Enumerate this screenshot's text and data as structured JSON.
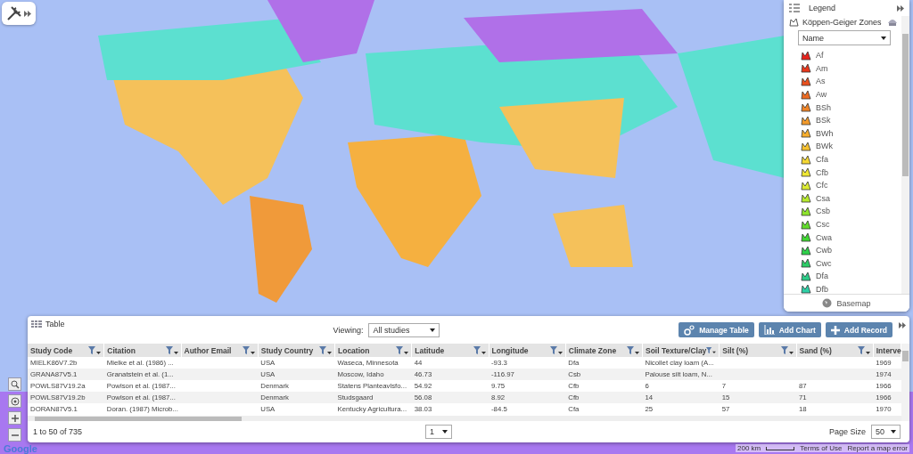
{
  "legend": {
    "title": "Legend",
    "layer": "Köppen-Geiger Zones",
    "field": "Name",
    "items": [
      {
        "label": "Af",
        "color": "#e8231c"
      },
      {
        "label": "Am",
        "color": "#e8381c"
      },
      {
        "label": "As",
        "color": "#e8501e"
      },
      {
        "label": "Aw",
        "color": "#ec6a22"
      },
      {
        "label": "BSh",
        "color": "#ef8427"
      },
      {
        "label": "BSk",
        "color": "#f29a2b"
      },
      {
        "label": "BWh",
        "color": "#f5ad2e"
      },
      {
        "label": "BWk",
        "color": "#f5c130"
      },
      {
        "label": "Cfa",
        "color": "#f5d833"
      },
      {
        "label": "Cfb",
        "color": "#eee634"
      },
      {
        "label": "Cfc",
        "color": "#dcec33"
      },
      {
        "label": "Csa",
        "color": "#b6ea2e"
      },
      {
        "label": "Csb",
        "color": "#8ee42c"
      },
      {
        "label": "Csc",
        "color": "#62dc2c"
      },
      {
        "label": "Cwa",
        "color": "#3fd632"
      },
      {
        "label": "Cwb",
        "color": "#2ed04a"
      },
      {
        "label": "Cwc",
        "color": "#2ccc66"
      },
      {
        "label": "Dfa",
        "color": "#2ccc88"
      },
      {
        "label": "Dfb",
        "color": "#2ed0a6"
      }
    ],
    "basemap": "Basemap"
  },
  "table": {
    "title": "Table",
    "viewing_label": "Viewing:",
    "viewing": "All studies",
    "buttons": [
      {
        "label": "Manage Table",
        "kind": "gears"
      },
      {
        "label": "Add Chart",
        "kind": "chart"
      },
      {
        "label": "Add Record",
        "kind": "plus"
      }
    ],
    "columns": [
      {
        "label": "Study Code",
        "filter": true
      },
      {
        "label": "Citation",
        "filter": true
      },
      {
        "label": "Author Email",
        "filter": true
      },
      {
        "label": "Study Country",
        "filter": true
      },
      {
        "label": "Location",
        "filter": true
      },
      {
        "label": "Latitude",
        "filter": true
      },
      {
        "label": "Longitude",
        "filter": true
      },
      {
        "label": "Climate Zone",
        "filter": true
      },
      {
        "label": "Soil Texture/Clay",
        "filter": true
      },
      {
        "label": "Silt (%)",
        "filter": true
      },
      {
        "label": "Sand (%)",
        "filter": true
      },
      {
        "label": "Interve",
        "filter": false
      }
    ],
    "rows": [
      [
        "MIELK86V7.2b",
        "Mielke et al. (1986) ...",
        "",
        "USA",
        "Waseca, Minnesota",
        "44",
        "-93.3",
        "Dfa",
        "Nicollet clay loam (A...",
        "",
        "",
        "1969"
      ],
      [
        "GRANA87V5.1",
        "Granatstein et al. (1...",
        "",
        "USA",
        "Moscow, Idaho",
        "46.73",
        "-116.97",
        "Csb",
        "Palouse silt loam, N...",
        "",
        "",
        "1974"
      ],
      [
        "POWLS87V19.2a",
        "Powlson et al. (1987...",
        "",
        "Denmark",
        "Statens Planteavlsfo...",
        "54.92",
        "9.75",
        "Cfb",
        "6",
        "7",
        "87",
        "1966"
      ],
      [
        "POWLS87V19.2b",
        "Powlson et al. (1987...",
        "",
        "Denmark",
        "Studsgaard",
        "56.08",
        "8.92",
        "Cfb",
        "14",
        "15",
        "71",
        "1966"
      ],
      [
        "DORAN87V5.1",
        "Doran. (1987) Microb...",
        "",
        "USA",
        "Kentucky Agricultura...",
        "38.03",
        "-84.5",
        "Cfa",
        "25",
        "57",
        "18",
        "1970"
      ]
    ],
    "record_count": "1 to 50 of 735",
    "page": "1",
    "page_size_label": "Page Size",
    "page_size": "50"
  },
  "attribution": {
    "logo": "Google",
    "scale": "200 km",
    "terms": "Terms of Use",
    "report": "Report a map error"
  }
}
